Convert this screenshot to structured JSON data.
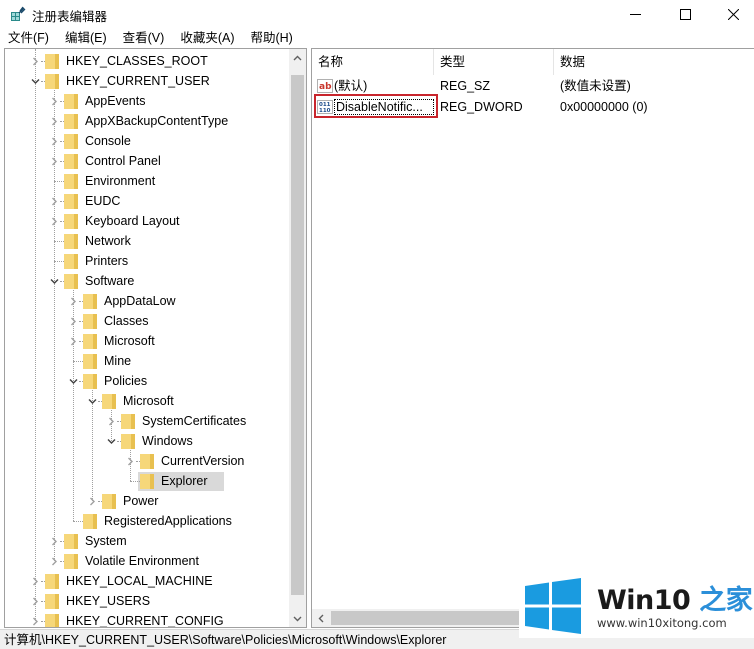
{
  "window": {
    "title": "注册表编辑器",
    "controls": {
      "minimize": "—",
      "maximize": "☐",
      "close": "✕"
    }
  },
  "menu": [
    "文件(F)",
    "编辑(E)",
    "查看(V)",
    "收藏夹(A)",
    "帮助(H)"
  ],
  "tree": {
    "selected_path": "计算机\\HKEY_CURRENT_USER\\Software\\Policies\\Microsoft\\Windows\\Explorer",
    "nodes": [
      {
        "label": "HKEY_CLASSES_ROOT",
        "depth": 0,
        "state": "collapsed"
      },
      {
        "label": "HKEY_CURRENT_USER",
        "depth": 0,
        "state": "expanded"
      },
      {
        "label": "AppEvents",
        "depth": 1,
        "state": "collapsed"
      },
      {
        "label": "AppXBackupContentType",
        "depth": 1,
        "state": "collapsed"
      },
      {
        "label": "Console",
        "depth": 1,
        "state": "collapsed"
      },
      {
        "label": "Control Panel",
        "depth": 1,
        "state": "collapsed"
      },
      {
        "label": "Environment",
        "depth": 1,
        "state": "leaf"
      },
      {
        "label": "EUDC",
        "depth": 1,
        "state": "collapsed"
      },
      {
        "label": "Keyboard Layout",
        "depth": 1,
        "state": "collapsed"
      },
      {
        "label": "Network",
        "depth": 1,
        "state": "leaf"
      },
      {
        "label": "Printers",
        "depth": 1,
        "state": "leaf"
      },
      {
        "label": "Software",
        "depth": 1,
        "state": "expanded"
      },
      {
        "label": "AppDataLow",
        "depth": 2,
        "state": "collapsed"
      },
      {
        "label": "Classes",
        "depth": 2,
        "state": "collapsed"
      },
      {
        "label": "Microsoft",
        "depth": 2,
        "state": "collapsed"
      },
      {
        "label": "Mine",
        "depth": 2,
        "state": "leaf"
      },
      {
        "label": "Policies",
        "depth": 2,
        "state": "expanded"
      },
      {
        "label": "Microsoft",
        "depth": 3,
        "state": "expanded"
      },
      {
        "label": "SystemCertificates",
        "depth": 4,
        "state": "collapsed"
      },
      {
        "label": "Windows",
        "depth": 4,
        "state": "expanded"
      },
      {
        "label": "CurrentVersion",
        "depth": 5,
        "state": "collapsed"
      },
      {
        "label": "Explorer",
        "depth": 5,
        "state": "leaf",
        "selected": true
      },
      {
        "label": "Power",
        "depth": 3,
        "state": "collapsed"
      },
      {
        "label": "RegisteredApplications",
        "depth": 2,
        "state": "leaf"
      },
      {
        "label": "System",
        "depth": 1,
        "state": "collapsed"
      },
      {
        "label": "Volatile Environment",
        "depth": 1,
        "state": "collapsed"
      },
      {
        "label": "HKEY_LOCAL_MACHINE",
        "depth": 0,
        "state": "collapsed"
      },
      {
        "label": "HKEY_USERS",
        "depth": 0,
        "state": "collapsed"
      },
      {
        "label": "HKEY_CURRENT_CONFIG",
        "depth": 0,
        "state": "collapsed"
      }
    ]
  },
  "values": {
    "columns": [
      "名称",
      "类型",
      "数据"
    ],
    "rows": [
      {
        "icon": "string-value-icon",
        "icon_text": "ab",
        "name": "(默认)",
        "type": "REG_SZ",
        "data": "(数值未设置)"
      },
      {
        "icon": "dword-value-icon",
        "icon_text": "011",
        "name": "DisableNotific...",
        "type": "REG_DWORD",
        "data": "0x00000000 (0)",
        "highlighted": true
      }
    ]
  },
  "statusbar": {
    "path": "计算机\\HKEY_CURRENT_USER\\Software\\Policies\\Microsoft\\Windows\\Explorer"
  },
  "watermark": {
    "title": "Win10",
    "title_accent": "之家",
    "url": "www.win10xitong.com",
    "brand_color": "#1a9be0",
    "accent_color": "#2b8fd9"
  },
  "colors": {
    "highlight_border": "#c8252c",
    "selection_bg": "#d9d9d9",
    "folder": "#f6d77a"
  }
}
